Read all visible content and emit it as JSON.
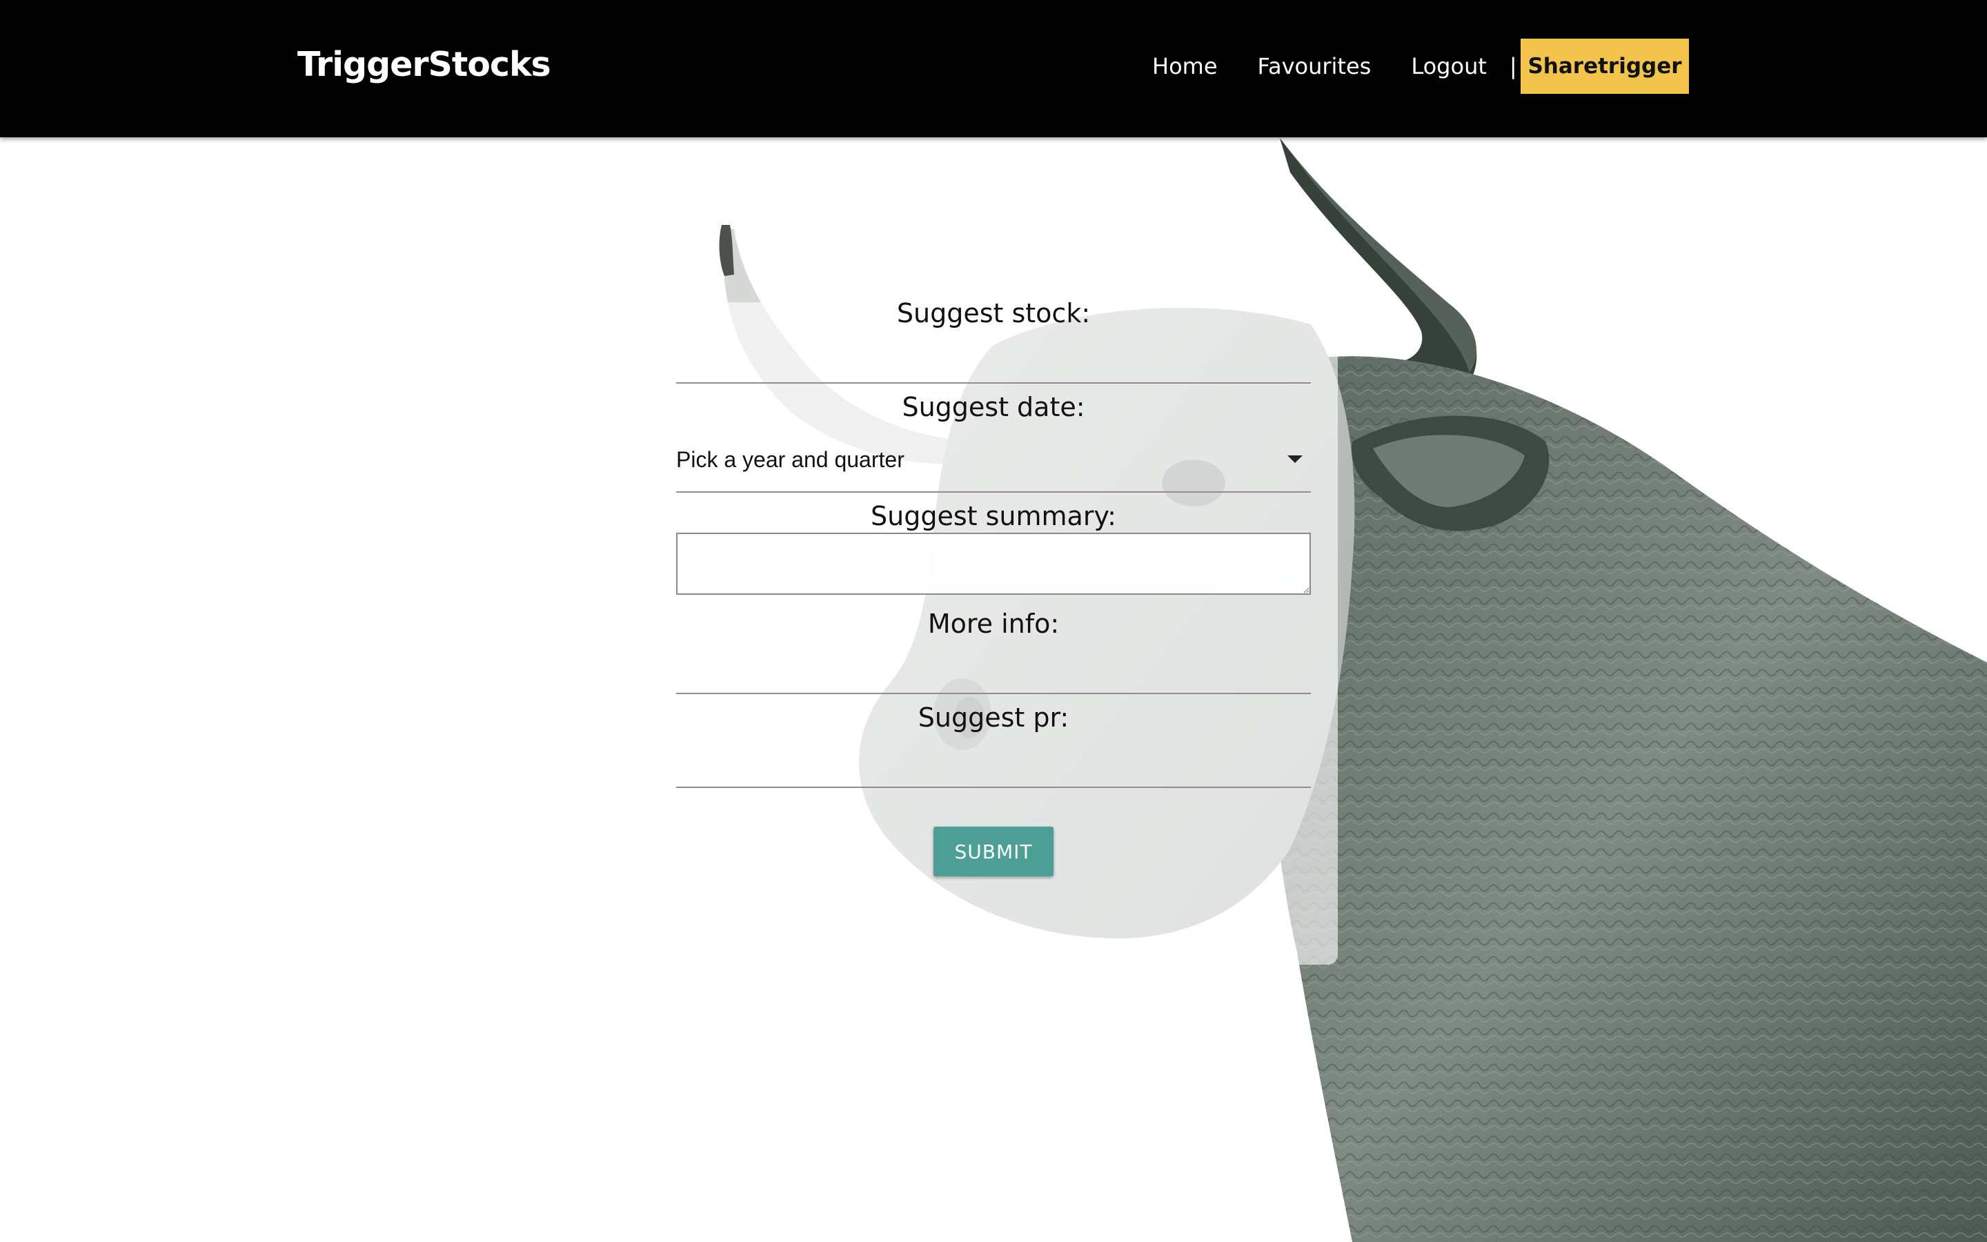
{
  "header": {
    "brand": "TriggerStocks",
    "nav": [
      {
        "label": "Home"
      },
      {
        "label": "Favourites"
      },
      {
        "label": "Logout"
      }
    ],
    "separator": "|",
    "cta_label": "Sharetrigger"
  },
  "form": {
    "stock_label": "Suggest stock:",
    "stock_value": "",
    "date_label": "Suggest date:",
    "date_selected": "Pick a year and quarter",
    "summary_label": "Suggest summary:",
    "summary_value": "",
    "more_info_label": "More info:",
    "more_info_value": "",
    "pr_label": "Suggest pr:",
    "pr_value": "",
    "submit_label": "SUBMIT"
  },
  "colors": {
    "header_bg": "#000000",
    "cta_bg": "#f2c44b",
    "submit_bg": "#4d9f96"
  },
  "background": {
    "illustration": "bull-photo"
  }
}
